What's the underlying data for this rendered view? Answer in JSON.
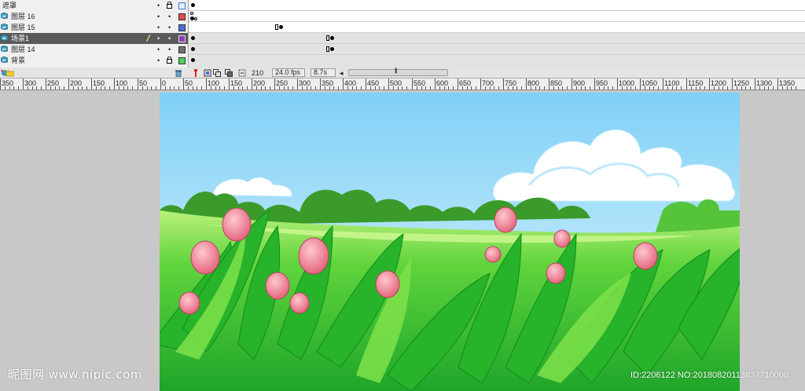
{
  "layers": [
    {
      "name": "遮罩",
      "color": "#dfefff",
      "locked": true,
      "selected": false,
      "icon": "mask-layer-icon"
    },
    {
      "name": "图层 16",
      "color": "#e04a4a",
      "locked": false,
      "selected": false,
      "icon": "layer-icon"
    },
    {
      "name": "图层 15",
      "color": "#4b6fd8",
      "locked": false,
      "selected": false,
      "icon": "layer-icon"
    },
    {
      "name": "场景1",
      "color": "#8e3bb8",
      "locked": false,
      "selected": true,
      "icon": "layer-icon"
    },
    {
      "name": "图层 14",
      "color": "#707070",
      "locked": false,
      "selected": false,
      "icon": "layer-icon"
    },
    {
      "name": "背景",
      "color": "#4fd45a",
      "locked": true,
      "selected": false,
      "icon": "layer-icon"
    }
  ],
  "timeline": {
    "current_frame": "210",
    "fps": "24.0 fps",
    "elapsed": "8.7s"
  },
  "ruler": {
    "labels": [
      "350",
      "300",
      "250",
      "200",
      "150",
      "100",
      "50",
      "0",
      "50",
      "100",
      "150",
      "200",
      "250",
      "300",
      "350",
      "400",
      "450",
      "500",
      "550",
      "600",
      "650",
      "700",
      "750",
      "800",
      "850",
      "900",
      "950",
      "1000",
      "1050",
      "1100",
      "1150",
      "1200",
      "1250",
      "1300",
      "1350"
    ]
  },
  "watermark": {
    "site": "昵图网 www.nipic.com",
    "id": "ID:2206122 NO:20180820113837710000"
  },
  "icons": {
    "trash": "trash-icon",
    "onion": "onion-skin-icon",
    "center": "center-frame-icon",
    "scroll": "scroll-left-icon"
  }
}
